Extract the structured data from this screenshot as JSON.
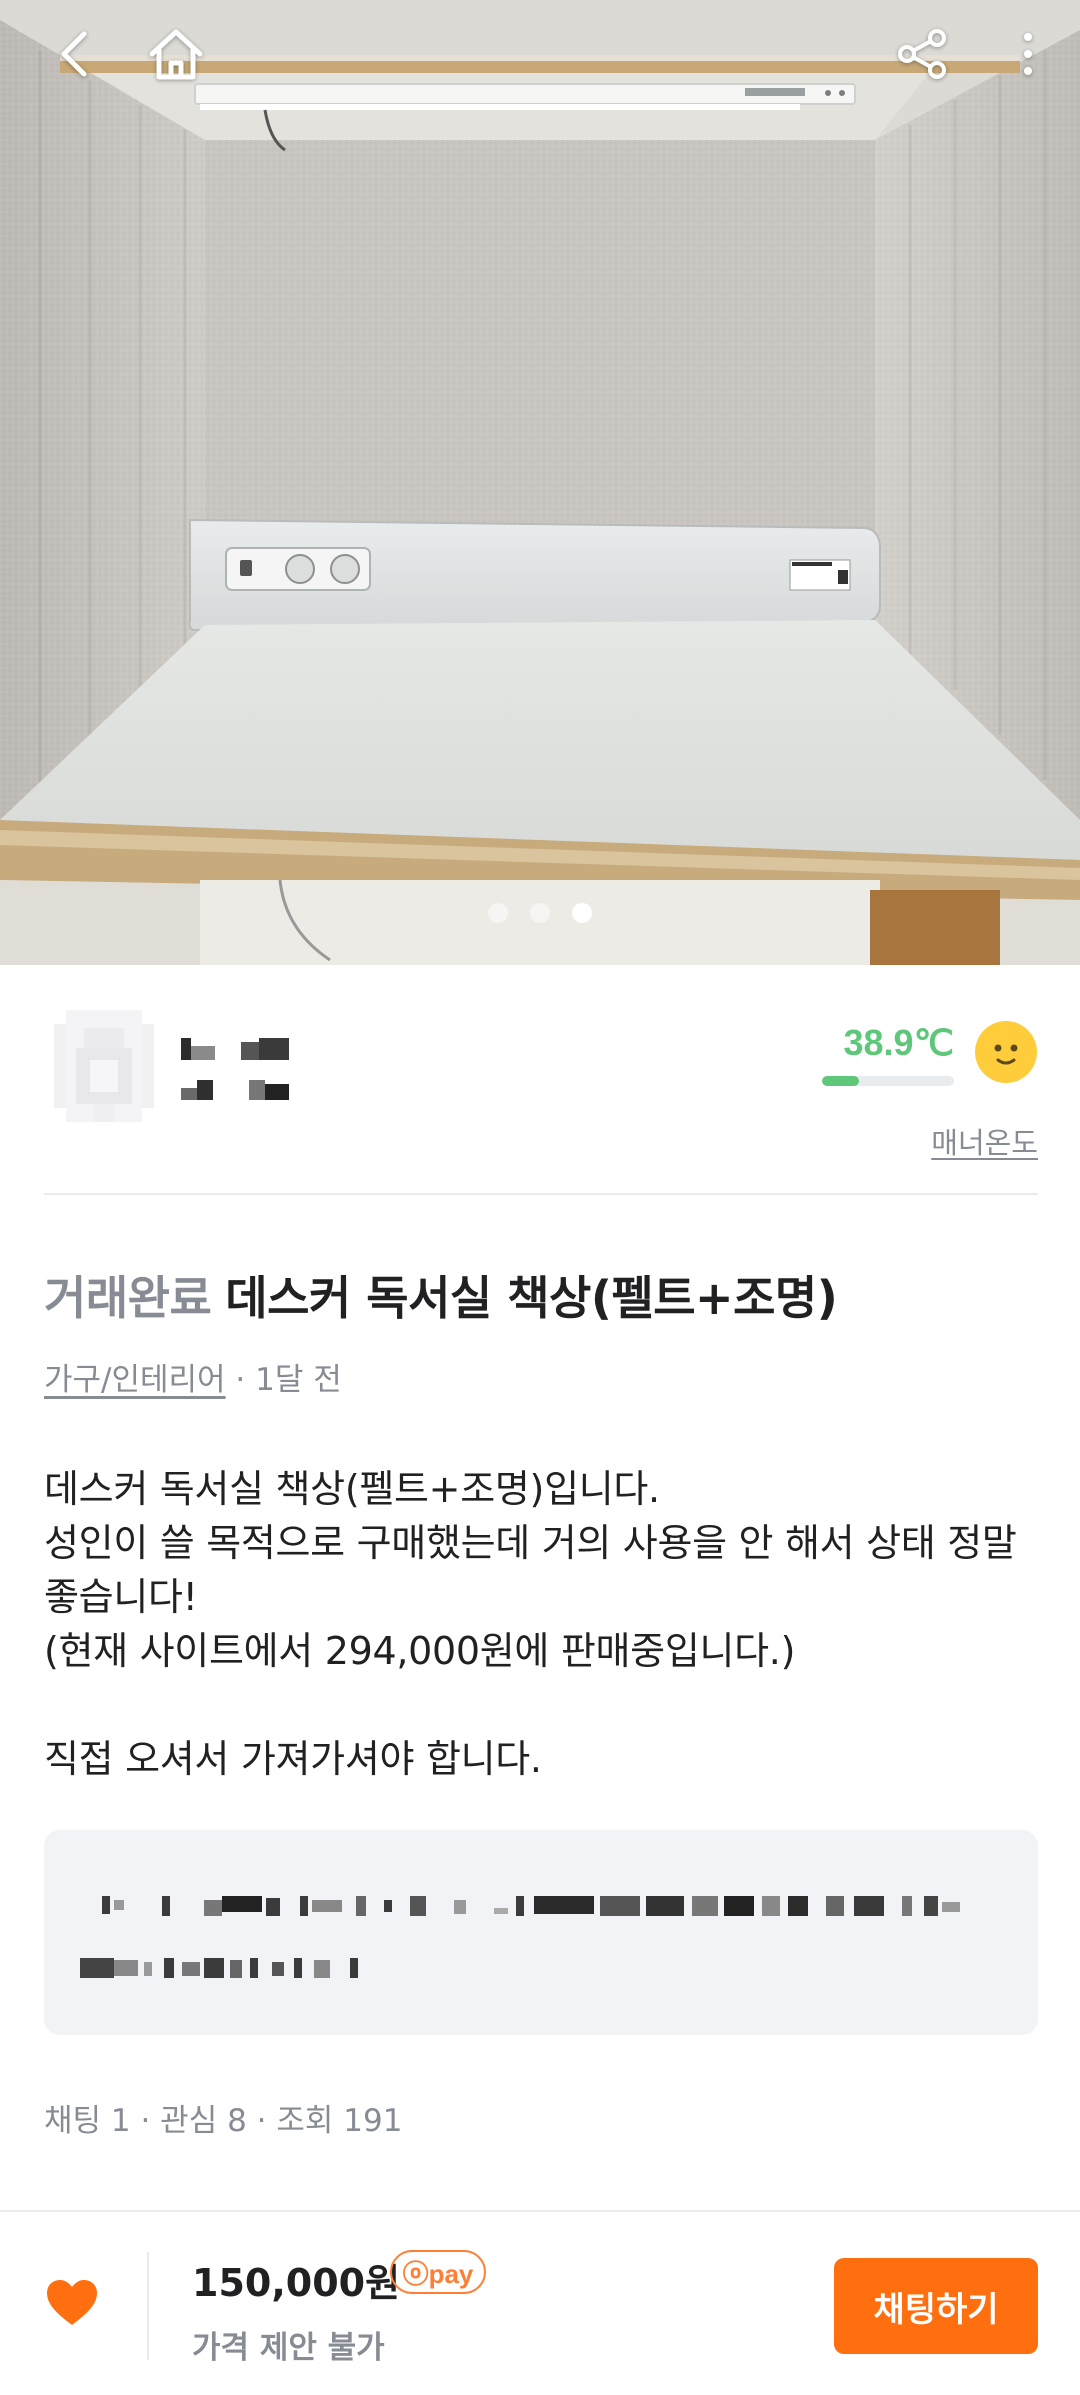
{
  "topbar": {
    "back_icon": "chevron-left-icon",
    "home_icon": "home-icon",
    "share_icon": "share-icon",
    "more_icon": "more-vertical-icon"
  },
  "carousel": {
    "total": 3,
    "active": 3
  },
  "seller": {
    "temperature": "38.9℃",
    "temperature_value": 38.9,
    "temperature_bar_fraction": 0.28,
    "manner_label": "매너온도",
    "temperature_color": "#5fc77a"
  },
  "post": {
    "status": "거래완료",
    "title": "데스커 독서실 책상(펠트+조명)",
    "category": "가구/인테리어",
    "time": " · 1달 전",
    "description": "데스커 독서실 책상(펠트+조명)입니다.\n성인이 쓸 목적으로 구매했는데 거의 사용을 안 해서 상태 정말 좋습니다!\n(현재 사이트에서 294,000원에 판매중입니다.)\n\n직접 오셔서 가져가셔야 합니다.",
    "stats": "채팅 1 · 관심 8 · 조회 191"
  },
  "bottom": {
    "price": "150,000원",
    "pay_badge": "ⓞpay",
    "no_offer": "가격 제안 불가",
    "chat_button": "채팅하기",
    "accent": "#ff6f0f"
  }
}
